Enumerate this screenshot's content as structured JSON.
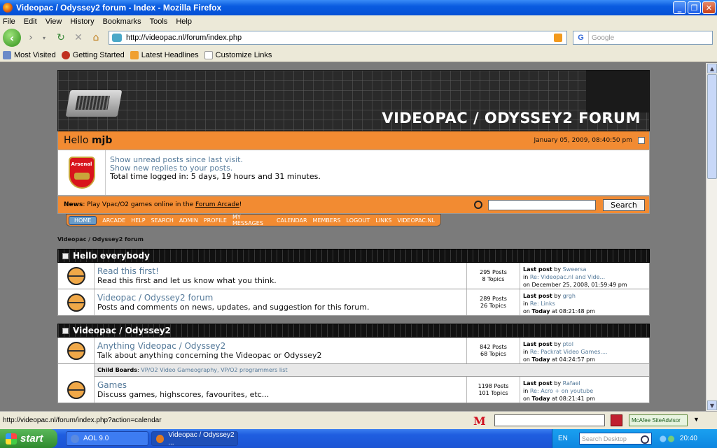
{
  "window": {
    "title": "Videopac / Odyssey2 forum - Index - Mozilla Firefox"
  },
  "menu": [
    "File",
    "Edit",
    "View",
    "History",
    "Bookmarks",
    "Tools",
    "Help"
  ],
  "navbar": {
    "url": "http://videopac.nl/forum/index.php",
    "search_placeholder": "Google"
  },
  "bookmarks": [
    "Most Visited",
    "Getting Started",
    "Latest Headlines",
    "Customize Links"
  ],
  "forum": {
    "logo": "VIDEOPAC / ODYSSEY2 FORUM",
    "greeting": "Hello",
    "username": "mjb",
    "date": "January 05, 2009, 08:40:50 pm",
    "avatar_text": "Arsenal",
    "unread": "Show unread posts since last visit.",
    "replies": "Show new replies to your posts.",
    "time_logged": "Total time logged in: 5 days, 19 hours and 31 minutes.",
    "news_label": "News",
    "news_text": ": Play Vpac/O2 games online in the ",
    "news_link": "Forum Arcade",
    "news_end": "!",
    "search_btn": "Search",
    "nav": [
      "HOME",
      "ARCADE",
      "HELP",
      "SEARCH",
      "ADMIN",
      "PROFILE",
      "MY MESSAGES",
      "CALENDAR",
      "MEMBERS",
      "LOGOUT",
      "LINKS",
      "VIDEOPAC.NL"
    ],
    "breadcrumb": "Videopac / Odyssey2 forum",
    "categories": [
      {
        "title": "Hello everybody",
        "boards": [
          {
            "name": "Read this first!",
            "desc": "Read this first and let us know what you think.",
            "posts": "295 Posts",
            "topics": "8 Topics",
            "last_by": "Sweersa",
            "last_in": "Re: Videopac.nl and Vide...",
            "last_on": "on December 25, 2008, 01:59:49 pm"
          },
          {
            "name": "Videopac / Odyssey2 forum",
            "desc": "Posts and comments on news, updates, and suggestion for this forum.",
            "posts": "289 Posts",
            "topics": "26 Topics",
            "last_by": "grgh",
            "last_in": "Re: Links",
            "last_on_b": "Today",
            "last_on": " at 08:21:48 pm"
          }
        ]
      },
      {
        "title": "Videopac / Odyssey2",
        "boards": [
          {
            "name": "Anything Videopac / Odyssey2",
            "desc": "Talk about anything concerning the Videopac or Odyssey2",
            "posts": "842 Posts",
            "topics": "68 Topics",
            "last_by": "ptol",
            "last_in": "Re: Packrat Video Games....",
            "last_on_b": "Today",
            "last_on": " at 04:24:57 pm",
            "child_label": "Child Boards",
            "child": "VP/O2 Video Gameography, VP/O2 programmers list"
          },
          {
            "name": "Games",
            "desc": "Discuss games, highscores, favourites, etc...",
            "posts": "1198 Posts",
            "topics": "101 Topics",
            "last_by": "Rafael",
            "last_in": "Re: Acro + on youtube",
            "last_on_b": "Today",
            "last_on": " at 08:21:41 pm"
          }
        ]
      }
    ],
    "last_post_label": "Last post",
    "by_label": "by",
    "in_label": "in",
    "on_label": "on"
  },
  "status": {
    "url": "http://videopac.nl/forum/index.php?action=calendar",
    "siteadvisor": "McAfee SiteAdvisor"
  },
  "taskbar": {
    "start": "start",
    "tasks": [
      "AOL 9.0",
      "Videopac / Odyssey2 ..."
    ],
    "lang": "EN",
    "search": "Search Desktop",
    "clock": "20:40"
  }
}
